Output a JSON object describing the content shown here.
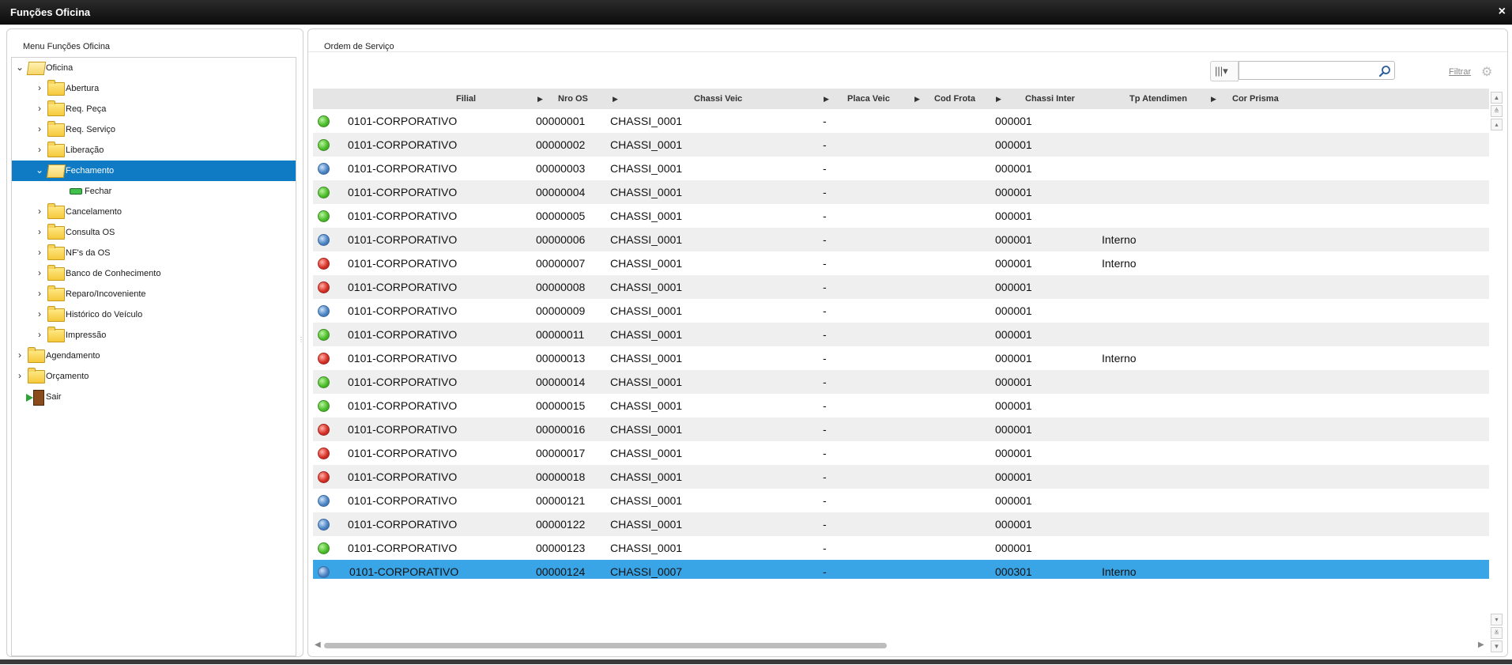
{
  "window": {
    "title": "Funções Oficina",
    "close_label": "×"
  },
  "left_panel": {
    "header": "Menu Funções Oficina",
    "tree": [
      {
        "label": "Oficina",
        "level": 0,
        "expanded": true,
        "icon": "folder-open-icon"
      },
      {
        "label": "Abertura",
        "level": 1,
        "expanded": false,
        "icon": "folder-icon"
      },
      {
        "label": "Req. Peça",
        "level": 1,
        "expanded": false,
        "icon": "folder-icon"
      },
      {
        "label": "Req. Serviço",
        "level": 1,
        "expanded": false,
        "icon": "folder-icon"
      },
      {
        "label": "Liberação",
        "level": 1,
        "expanded": false,
        "icon": "folder-icon"
      },
      {
        "label": "Fechamento",
        "level": 1,
        "expanded": true,
        "selected": true,
        "icon": "folder-open-icon"
      },
      {
        "label": "Fechar",
        "level": 2,
        "leaf": true,
        "icon": "function-icon"
      },
      {
        "label": "Cancelamento",
        "level": 1,
        "expanded": false,
        "icon": "folder-icon"
      },
      {
        "label": "Consulta OS",
        "level": 1,
        "expanded": false,
        "icon": "folder-icon"
      },
      {
        "label": "NF's da OS",
        "level": 1,
        "expanded": false,
        "icon": "folder-icon"
      },
      {
        "label": "Banco de Conhecimento",
        "level": 1,
        "expanded": false,
        "icon": "folder-icon"
      },
      {
        "label": "Reparo/Incoveniente",
        "level": 1,
        "expanded": false,
        "icon": "folder-icon"
      },
      {
        "label": "Histórico do Veículo",
        "level": 1,
        "expanded": false,
        "icon": "folder-icon"
      },
      {
        "label": "Impressão",
        "level": 1,
        "expanded": false,
        "icon": "folder-icon"
      },
      {
        "label": "Agendamento",
        "level": 0,
        "expanded": false,
        "icon": "folder-icon"
      },
      {
        "label": "Orçamento",
        "level": 0,
        "expanded": false,
        "icon": "folder-icon"
      },
      {
        "label": "Sair",
        "level": 0,
        "leaf": true,
        "icon": "exit-icon"
      }
    ]
  },
  "right_panel": {
    "header": "Ordem de Serviço",
    "search": {
      "value": "",
      "placeholder": ""
    },
    "filter_label": "Filtrar",
    "columns": [
      "Filial",
      "Nro OS",
      "Chassi Veic",
      "Placa Veic",
      "Cod Frota",
      "Chassi Inter",
      "Tp Atendimen",
      "Cor Prisma"
    ],
    "rows": [
      {
        "status": "green",
        "filial": "0101-CORPORATIVO",
        "nro_os": "00000001",
        "chassi": "CHASSI_0001",
        "placa": "-",
        "frota": "",
        "chassi_inter": "000001",
        "tp": ""
      },
      {
        "status": "green",
        "filial": "0101-CORPORATIVO",
        "nro_os": "00000002",
        "chassi": "CHASSI_0001",
        "placa": "-",
        "frota": "",
        "chassi_inter": "000001",
        "tp": ""
      },
      {
        "status": "blue",
        "filial": "0101-CORPORATIVO",
        "nro_os": "00000003",
        "chassi": "CHASSI_0001",
        "placa": "-",
        "frota": "",
        "chassi_inter": "000001",
        "tp": ""
      },
      {
        "status": "green",
        "filial": "0101-CORPORATIVO",
        "nro_os": "00000004",
        "chassi": "CHASSI_0001",
        "placa": "-",
        "frota": "",
        "chassi_inter": "000001",
        "tp": ""
      },
      {
        "status": "green",
        "filial": "0101-CORPORATIVO",
        "nro_os": "00000005",
        "chassi": "CHASSI_0001",
        "placa": "-",
        "frota": "",
        "chassi_inter": "000001",
        "tp": ""
      },
      {
        "status": "blue",
        "filial": "0101-CORPORATIVO",
        "nro_os": "00000006",
        "chassi": "CHASSI_0001",
        "placa": "-",
        "frota": "",
        "chassi_inter": "000001",
        "tp": "Interno"
      },
      {
        "status": "red",
        "filial": "0101-CORPORATIVO",
        "nro_os": "00000007",
        "chassi": "CHASSI_0001",
        "placa": "-",
        "frota": "",
        "chassi_inter": "000001",
        "tp": "Interno"
      },
      {
        "status": "red",
        "filial": "0101-CORPORATIVO",
        "nro_os": "00000008",
        "chassi": "CHASSI_0001",
        "placa": "-",
        "frota": "",
        "chassi_inter": "000001",
        "tp": ""
      },
      {
        "status": "blue",
        "filial": "0101-CORPORATIVO",
        "nro_os": "00000009",
        "chassi": "CHASSI_0001",
        "placa": "-",
        "frota": "",
        "chassi_inter": "000001",
        "tp": ""
      },
      {
        "status": "green",
        "filial": "0101-CORPORATIVO",
        "nro_os": "00000011",
        "chassi": "CHASSI_0001",
        "placa": "-",
        "frota": "",
        "chassi_inter": "000001",
        "tp": ""
      },
      {
        "status": "red",
        "filial": "0101-CORPORATIVO",
        "nro_os": "00000013",
        "chassi": "CHASSI_0001",
        "placa": "-",
        "frota": "",
        "chassi_inter": "000001",
        "tp": "Interno"
      },
      {
        "status": "green",
        "filial": "0101-CORPORATIVO",
        "nro_os": "00000014",
        "chassi": "CHASSI_0001",
        "placa": "-",
        "frota": "",
        "chassi_inter": "000001",
        "tp": ""
      },
      {
        "status": "green",
        "filial": "0101-CORPORATIVO",
        "nro_os": "00000015",
        "chassi": "CHASSI_0001",
        "placa": "-",
        "frota": "",
        "chassi_inter": "000001",
        "tp": ""
      },
      {
        "status": "red",
        "filial": "0101-CORPORATIVO",
        "nro_os": "00000016",
        "chassi": "CHASSI_0001",
        "placa": "-",
        "frota": "",
        "chassi_inter": "000001",
        "tp": ""
      },
      {
        "status": "red",
        "filial": "0101-CORPORATIVO",
        "nro_os": "00000017",
        "chassi": "CHASSI_0001",
        "placa": "-",
        "frota": "",
        "chassi_inter": "000001",
        "tp": ""
      },
      {
        "status": "red",
        "filial": "0101-CORPORATIVO",
        "nro_os": "00000018",
        "chassi": "CHASSI_0001",
        "placa": "-",
        "frota": "",
        "chassi_inter": "000001",
        "tp": ""
      },
      {
        "status": "blue",
        "filial": "0101-CORPORATIVO",
        "nro_os": "00000121",
        "chassi": "CHASSI_0001",
        "placa": "-",
        "frota": "",
        "chassi_inter": "000001",
        "tp": ""
      },
      {
        "status": "blue",
        "filial": "0101-CORPORATIVO",
        "nro_os": "00000122",
        "chassi": "CHASSI_0001",
        "placa": "-",
        "frota": "",
        "chassi_inter": "000001",
        "tp": ""
      },
      {
        "status": "green",
        "filial": "0101-CORPORATIVO",
        "nro_os": "00000123",
        "chassi": "CHASSI_0001",
        "placa": "-",
        "frota": "",
        "chassi_inter": "000001",
        "tp": ""
      },
      {
        "status": "blue",
        "filial": "0101-CORPORATIVO",
        "nro_os": "00000124",
        "chassi": "CHASSI_0007",
        "placa": "-",
        "frota": "",
        "chassi_inter": "000301",
        "tp": "Interno",
        "selected": true
      }
    ]
  },
  "colors": {
    "selected_tree": "#0f7bc4",
    "selected_row": "#3aa5e6",
    "titlebar": "#111111"
  }
}
